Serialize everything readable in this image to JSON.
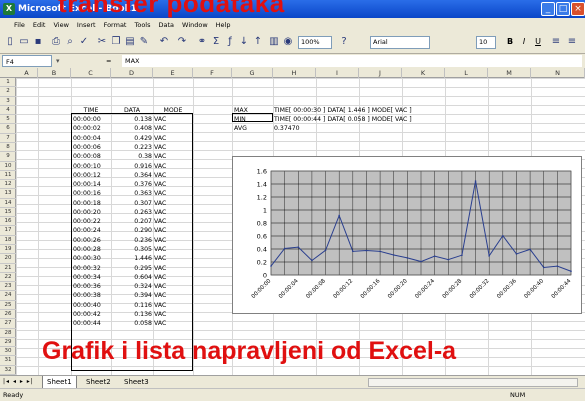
{
  "window": {
    "title": "Microsoft Excel - Book1"
  },
  "slide": {
    "top_title": "transfer podataka",
    "bottom_title": "Grafik i lista napravljeni od Excel-a"
  },
  "menu": [
    "File",
    "Edit",
    "View",
    "Insert",
    "Format",
    "Tools",
    "Data",
    "Window",
    "Help"
  ],
  "toolbar": {
    "zoom": "100%",
    "font": "Arial",
    "font_size": "10",
    "bold": "B",
    "italic": "I",
    "underline": "U"
  },
  "formula": {
    "name_box": "F4",
    "equals": "=",
    "content": "MAX"
  },
  "columns": [
    "A",
    "B",
    "C",
    "D",
    "E",
    "F",
    "G",
    "H",
    "I",
    "J",
    "K",
    "L",
    "M",
    "N"
  ],
  "rows": [
    "1",
    "2",
    "3",
    "4",
    "5",
    "6",
    "7",
    "8",
    "9",
    "10",
    "11",
    "12",
    "13",
    "14",
    "15",
    "16",
    "17",
    "18",
    "19",
    "20",
    "21",
    "22",
    "23",
    "24",
    "25",
    "26",
    "27",
    "28",
    "29",
    "30",
    "31",
    "32"
  ],
  "table": {
    "headers": [
      "TIME",
      "DATA",
      "MODE"
    ],
    "rows": [
      [
        "00:00:00",
        "0.138",
        "VAC"
      ],
      [
        "00:00:02",
        "0.408",
        "VAC"
      ],
      [
        "00:00:04",
        "0.429",
        "VAC"
      ],
      [
        "00:00:06",
        "0.223",
        "VAC"
      ],
      [
        "00:00:08",
        "0.38",
        "VAC"
      ],
      [
        "00:00:10",
        "0.916",
        "VAC"
      ],
      [
        "00:00:12",
        "0.364",
        "VAC"
      ],
      [
        "00:00:14",
        "0.376",
        "VAC"
      ],
      [
        "00:00:16",
        "0.363",
        "VAC"
      ],
      [
        "00:00:18",
        "0.307",
        "VAC"
      ],
      [
        "00:00:20",
        "0.263",
        "VAC"
      ],
      [
        "00:00:22",
        "0.207",
        "VAC"
      ],
      [
        "00:00:24",
        "0.290",
        "VAC"
      ],
      [
        "00:00:26",
        "0.236",
        "VAC"
      ],
      [
        "00:00:28",
        "0.305",
        "VAC"
      ],
      [
        "00:00:30",
        "1.446",
        "VAC"
      ],
      [
        "00:00:32",
        "0.295",
        "VAC"
      ],
      [
        "00:00:34",
        "0.604",
        "VAC"
      ],
      [
        "00:00:36",
        "0.324",
        "VAC"
      ],
      [
        "00:00:38",
        "0.394",
        "VAC"
      ],
      [
        "00:00:40",
        "0.116",
        "VAC"
      ],
      [
        "00:00:42",
        "0.136",
        "VAC"
      ],
      [
        "00:00:44",
        "0.058",
        "VAC"
      ]
    ]
  },
  "stats": [
    {
      "label": "MAX",
      "text": "TIME[ 00:00:30 ]   DATA[ 1.446 ]   MODE[ VAC ]"
    },
    {
      "label": "MIN",
      "text": "TIME[ 00:00:44 ]   DATA[ 0.058 ]   MODE[ VAC ]"
    },
    {
      "label": "AVG",
      "text": "0.37470"
    }
  ],
  "sheet_tabs": [
    "Sheet1",
    "Sheet2",
    "Sheet3"
  ],
  "status": {
    "left": "Ready",
    "right": "NUM"
  },
  "chart_data": {
    "type": "line",
    "x": [
      "00:00:00",
      "00:00:02",
      "00:00:04",
      "00:00:06",
      "00:00:08",
      "00:00:10",
      "00:00:12",
      "00:00:14",
      "00:00:16",
      "00:00:18",
      "00:00:20",
      "00:00:22",
      "00:00:24",
      "00:00:26",
      "00:00:28",
      "00:00:30",
      "00:00:32",
      "00:00:34",
      "00:00:36",
      "00:00:38",
      "00:00:40",
      "00:00:42",
      "00:00:44"
    ],
    "x_tick_labels": [
      "00:00:00",
      "00:00:04",
      "00:00:08",
      "00:00:12",
      "00:00:16",
      "00:00:20",
      "00:00:24",
      "00:00:28",
      "00:00:32",
      "00:00:36",
      "00:00:40",
      "00:00:44"
    ],
    "values": [
      0.138,
      0.408,
      0.429,
      0.223,
      0.38,
      0.916,
      0.364,
      0.376,
      0.363,
      0.307,
      0.263,
      0.207,
      0.29,
      0.236,
      0.305,
      1.446,
      0.295,
      0.604,
      0.324,
      0.394,
      0.116,
      0.136,
      0.058
    ],
    "ylim": [
      0,
      1.6
    ],
    "y_ticks": [
      "0",
      "0.2",
      "0.4",
      "0.6",
      "0.8",
      "1",
      "1.2",
      "1.4",
      "1.6"
    ],
    "grid": true,
    "colors": {
      "line": "#2a3f8f",
      "plot_bg": "#c0c0c0"
    }
  }
}
